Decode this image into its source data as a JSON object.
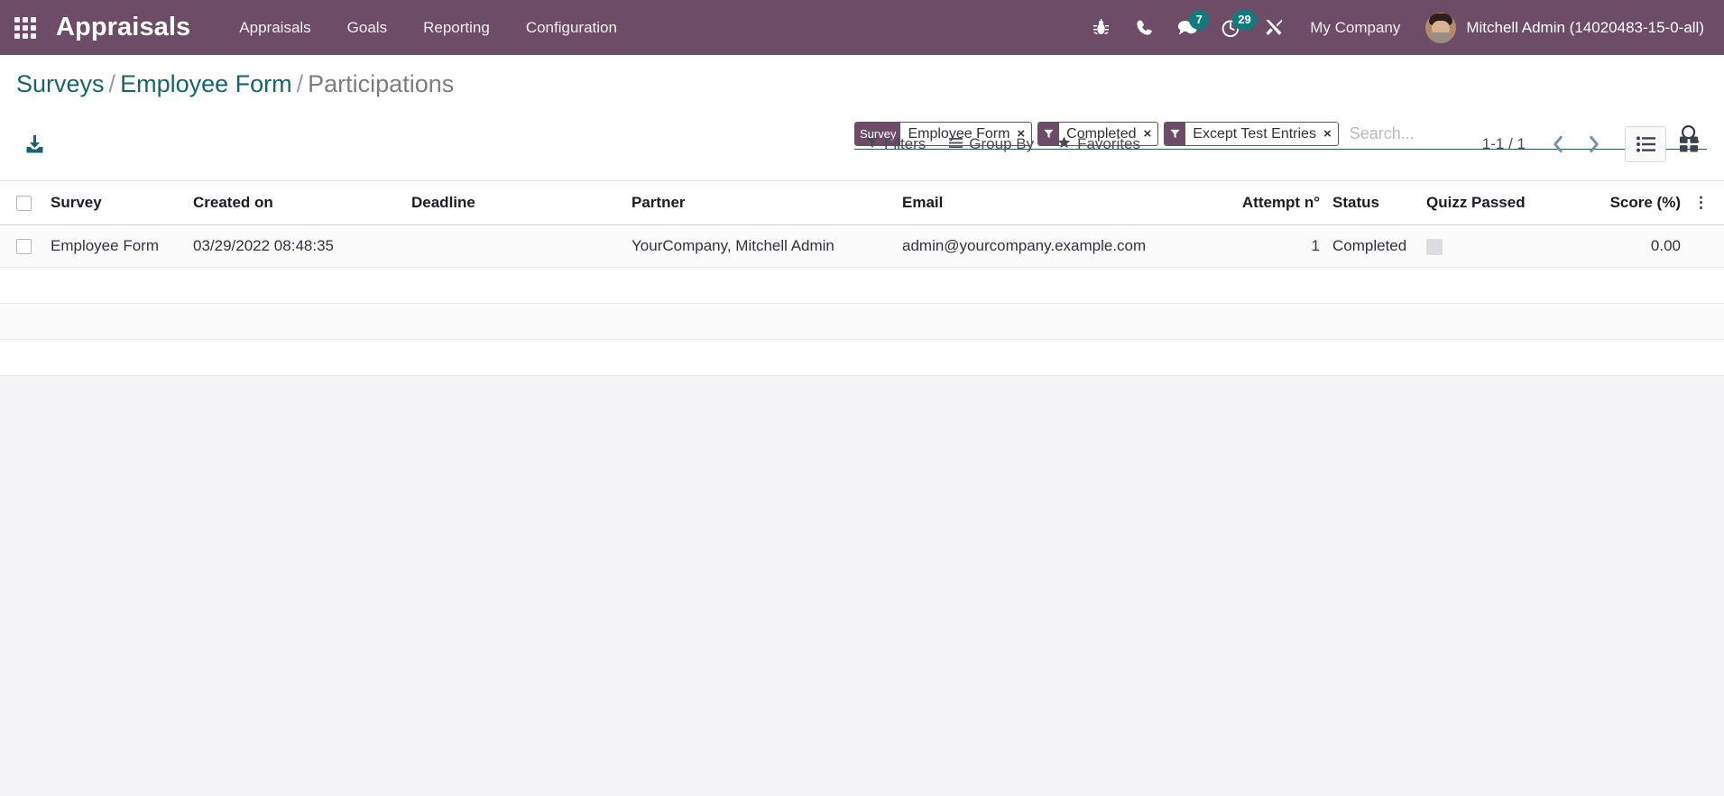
{
  "navbar": {
    "apps_icon": "apps-grid-icon",
    "brand": "Appraisals",
    "menu": [
      {
        "label": "Appraisals"
      },
      {
        "label": "Goals"
      },
      {
        "label": "Reporting"
      },
      {
        "label": "Configuration"
      }
    ],
    "sysicons": [
      {
        "name": "bug-icon",
        "badge": null
      },
      {
        "name": "phone-icon",
        "badge": null
      },
      {
        "name": "messages-icon",
        "badge": "7"
      },
      {
        "name": "activities-clock-icon",
        "badge": "29"
      },
      {
        "name": "developer-tools-icon",
        "badge": null
      }
    ],
    "company": "My Company",
    "user": "Mitchell Admin (14020483-15-0-all)",
    "bg_color": "#6c4c66",
    "badge_color": "#0e7b7f"
  },
  "breadcrumb": {
    "items": [
      {
        "label": "Surveys",
        "link": true
      },
      {
        "label": "Employee Form",
        "link": true
      },
      {
        "label": "Participations",
        "link": false
      }
    ],
    "separator": "/"
  },
  "search": {
    "placeholder": "Search...",
    "value": "",
    "search_icon": "magnifier-icon",
    "facets": [
      {
        "label": "Survey",
        "icon": null,
        "value": "Employee Form",
        "remove": "×"
      },
      {
        "label": null,
        "icon": "filter-funnel-icon",
        "value": "Completed",
        "remove": "×"
      },
      {
        "label": null,
        "icon": "filter-funnel-icon",
        "value": "Except Test Entries",
        "remove": "×"
      }
    ]
  },
  "toolbar": {
    "left_buttons": [
      {
        "name": "import-records-button",
        "icon": "download-import-icon"
      }
    ],
    "menus": [
      {
        "label": "Filters",
        "icon": "funnel-icon"
      },
      {
        "label": "Group By",
        "icon": "bars-icon"
      },
      {
        "label": "Favorites",
        "icon": "star-icon"
      }
    ],
    "pager": {
      "value": "1-1 / 1",
      "prev_icon": "chevron-left-icon",
      "next_icon": "chevron-right-icon"
    },
    "views": [
      {
        "name": "list-view",
        "icon": "list-icon",
        "active": true
      },
      {
        "name": "kanban-view",
        "icon": "kanban-icon",
        "active": false
      }
    ]
  },
  "table": {
    "select_all": false,
    "columns": [
      {
        "label": "Survey",
        "align": "left"
      },
      {
        "label": "Created on",
        "align": "left"
      },
      {
        "label": "Deadline",
        "align": "left"
      },
      {
        "label": "Partner",
        "align": "left"
      },
      {
        "label": "Email",
        "align": "left"
      },
      {
        "label": "Attempt n°",
        "align": "right"
      },
      {
        "label": "Status",
        "align": "left"
      },
      {
        "label": "Quizz Passed",
        "align": "left"
      },
      {
        "label": "Score (%)",
        "align": "right"
      }
    ],
    "options_icon": "vertical-dots-icon",
    "rows": [
      {
        "survey": "Employee Form",
        "created_on": "03/29/2022 08:48:35",
        "deadline": "",
        "partner": "YourCompany, Mitchell Admin",
        "email": "admin@yourcompany.example.com",
        "attempt": "1",
        "status": "Completed",
        "quizz_passed": false,
        "score": "0.00"
      }
    ],
    "empty_rows": 3
  }
}
